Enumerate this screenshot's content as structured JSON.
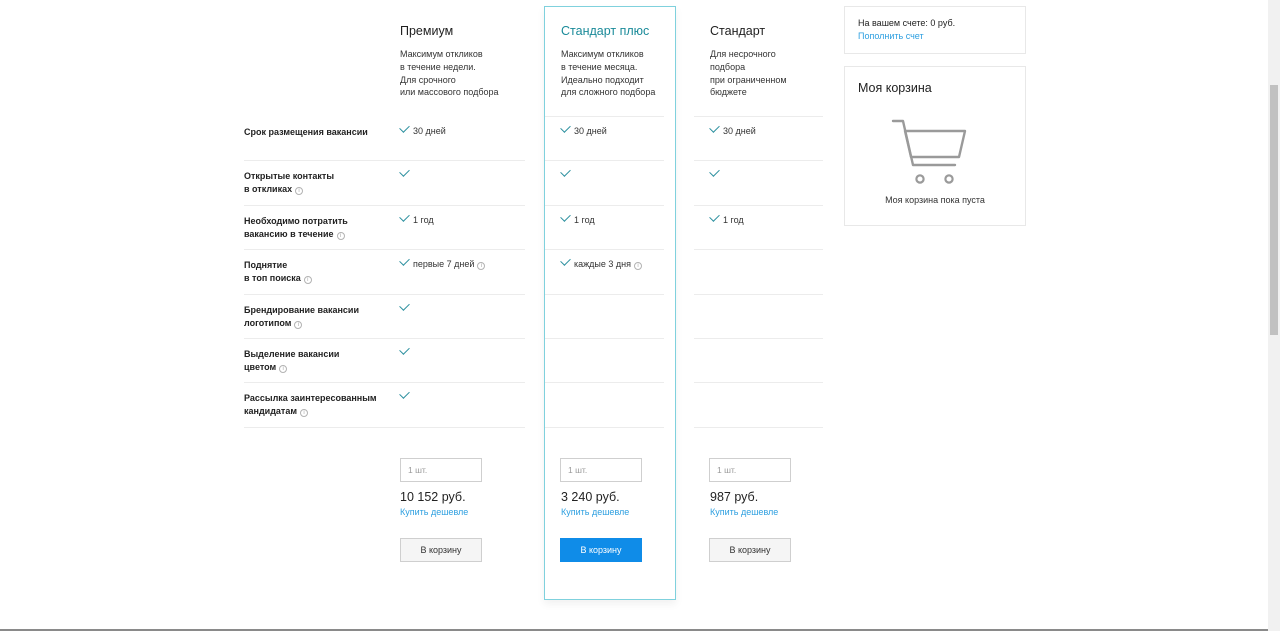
{
  "plans": [
    {
      "title": "Премиум",
      "desc": "Максимум откликов\nв течение недели.\nДля срочного\nили массового подбора",
      "qty_placeholder": "1 шт.",
      "price": "10 152 руб.",
      "cheaper": "Купить дешевле",
      "cart_button": "В корзину"
    },
    {
      "title": "Стандарт плюс",
      "desc": "Максимум откликов\nв течение месяца.\nИдеально подходит\nдля сложного подбора",
      "qty_placeholder": "1 шт.",
      "price": "3 240 руб.",
      "cheaper": "Купить дешевле",
      "cart_button": "В корзину"
    },
    {
      "title": "Стандарт",
      "desc": "Для несрочного\nподбора\nпри ограниченном\nбюджете",
      "qty_placeholder": "1 шт.",
      "price": "987 руб.",
      "cheaper": "Купить дешевле",
      "cart_button": "В корзину"
    }
  ],
  "features": [
    {
      "label": "Срок размещения вакансии",
      "info": false,
      "values": [
        "30 дней",
        "30 дней",
        "30 дней"
      ],
      "checks": [
        true,
        true,
        true
      ],
      "infos": [
        false,
        false,
        false
      ]
    },
    {
      "label": "Открытые контакты\nв откликах",
      "info": true,
      "values": [
        "",
        "",
        ""
      ],
      "checks": [
        true,
        true,
        true
      ],
      "infos": [
        false,
        false,
        false
      ]
    },
    {
      "label": "Необходимо потратить\nвакансию в течение",
      "info": true,
      "values": [
        "1 год",
        "1 год",
        "1 год"
      ],
      "checks": [
        true,
        true,
        true
      ],
      "infos": [
        false,
        false,
        false
      ]
    },
    {
      "label": "Поднятие\nв топ поиска",
      "info": true,
      "values": [
        "первые 7 дней",
        "каждые 3 дня",
        ""
      ],
      "checks": [
        true,
        true,
        false
      ],
      "infos": [
        true,
        true,
        false
      ]
    },
    {
      "label": "Брендирование вакансии\nлоготипом",
      "info": true,
      "values": [
        "",
        "",
        ""
      ],
      "checks": [
        true,
        false,
        false
      ],
      "infos": [
        false,
        false,
        false
      ]
    },
    {
      "label": "Выделение вакансии\nцветом",
      "info": true,
      "values": [
        "",
        "",
        ""
      ],
      "checks": [
        true,
        false,
        false
      ],
      "infos": [
        false,
        false,
        false
      ]
    },
    {
      "label": "Рассылка заинтересованным\nкандидатам",
      "info": true,
      "values": [
        "",
        "",
        ""
      ],
      "checks": [
        true,
        false,
        false
      ],
      "infos": [
        false,
        false,
        false
      ]
    }
  ],
  "info_glyph": "i",
  "account": {
    "balance": "На вашем счете: 0 руб.",
    "topup": "Пополнить счет"
  },
  "cart": {
    "title": "Моя корзина",
    "empty": "Моя корзина пока пуста",
    "icon": "shopping-cart-icon"
  },
  "colors": {
    "accent": "#1a8a99",
    "check": "#2a8f9e",
    "link": "#2d9fe0",
    "primary_button": "#0f8ce8"
  }
}
